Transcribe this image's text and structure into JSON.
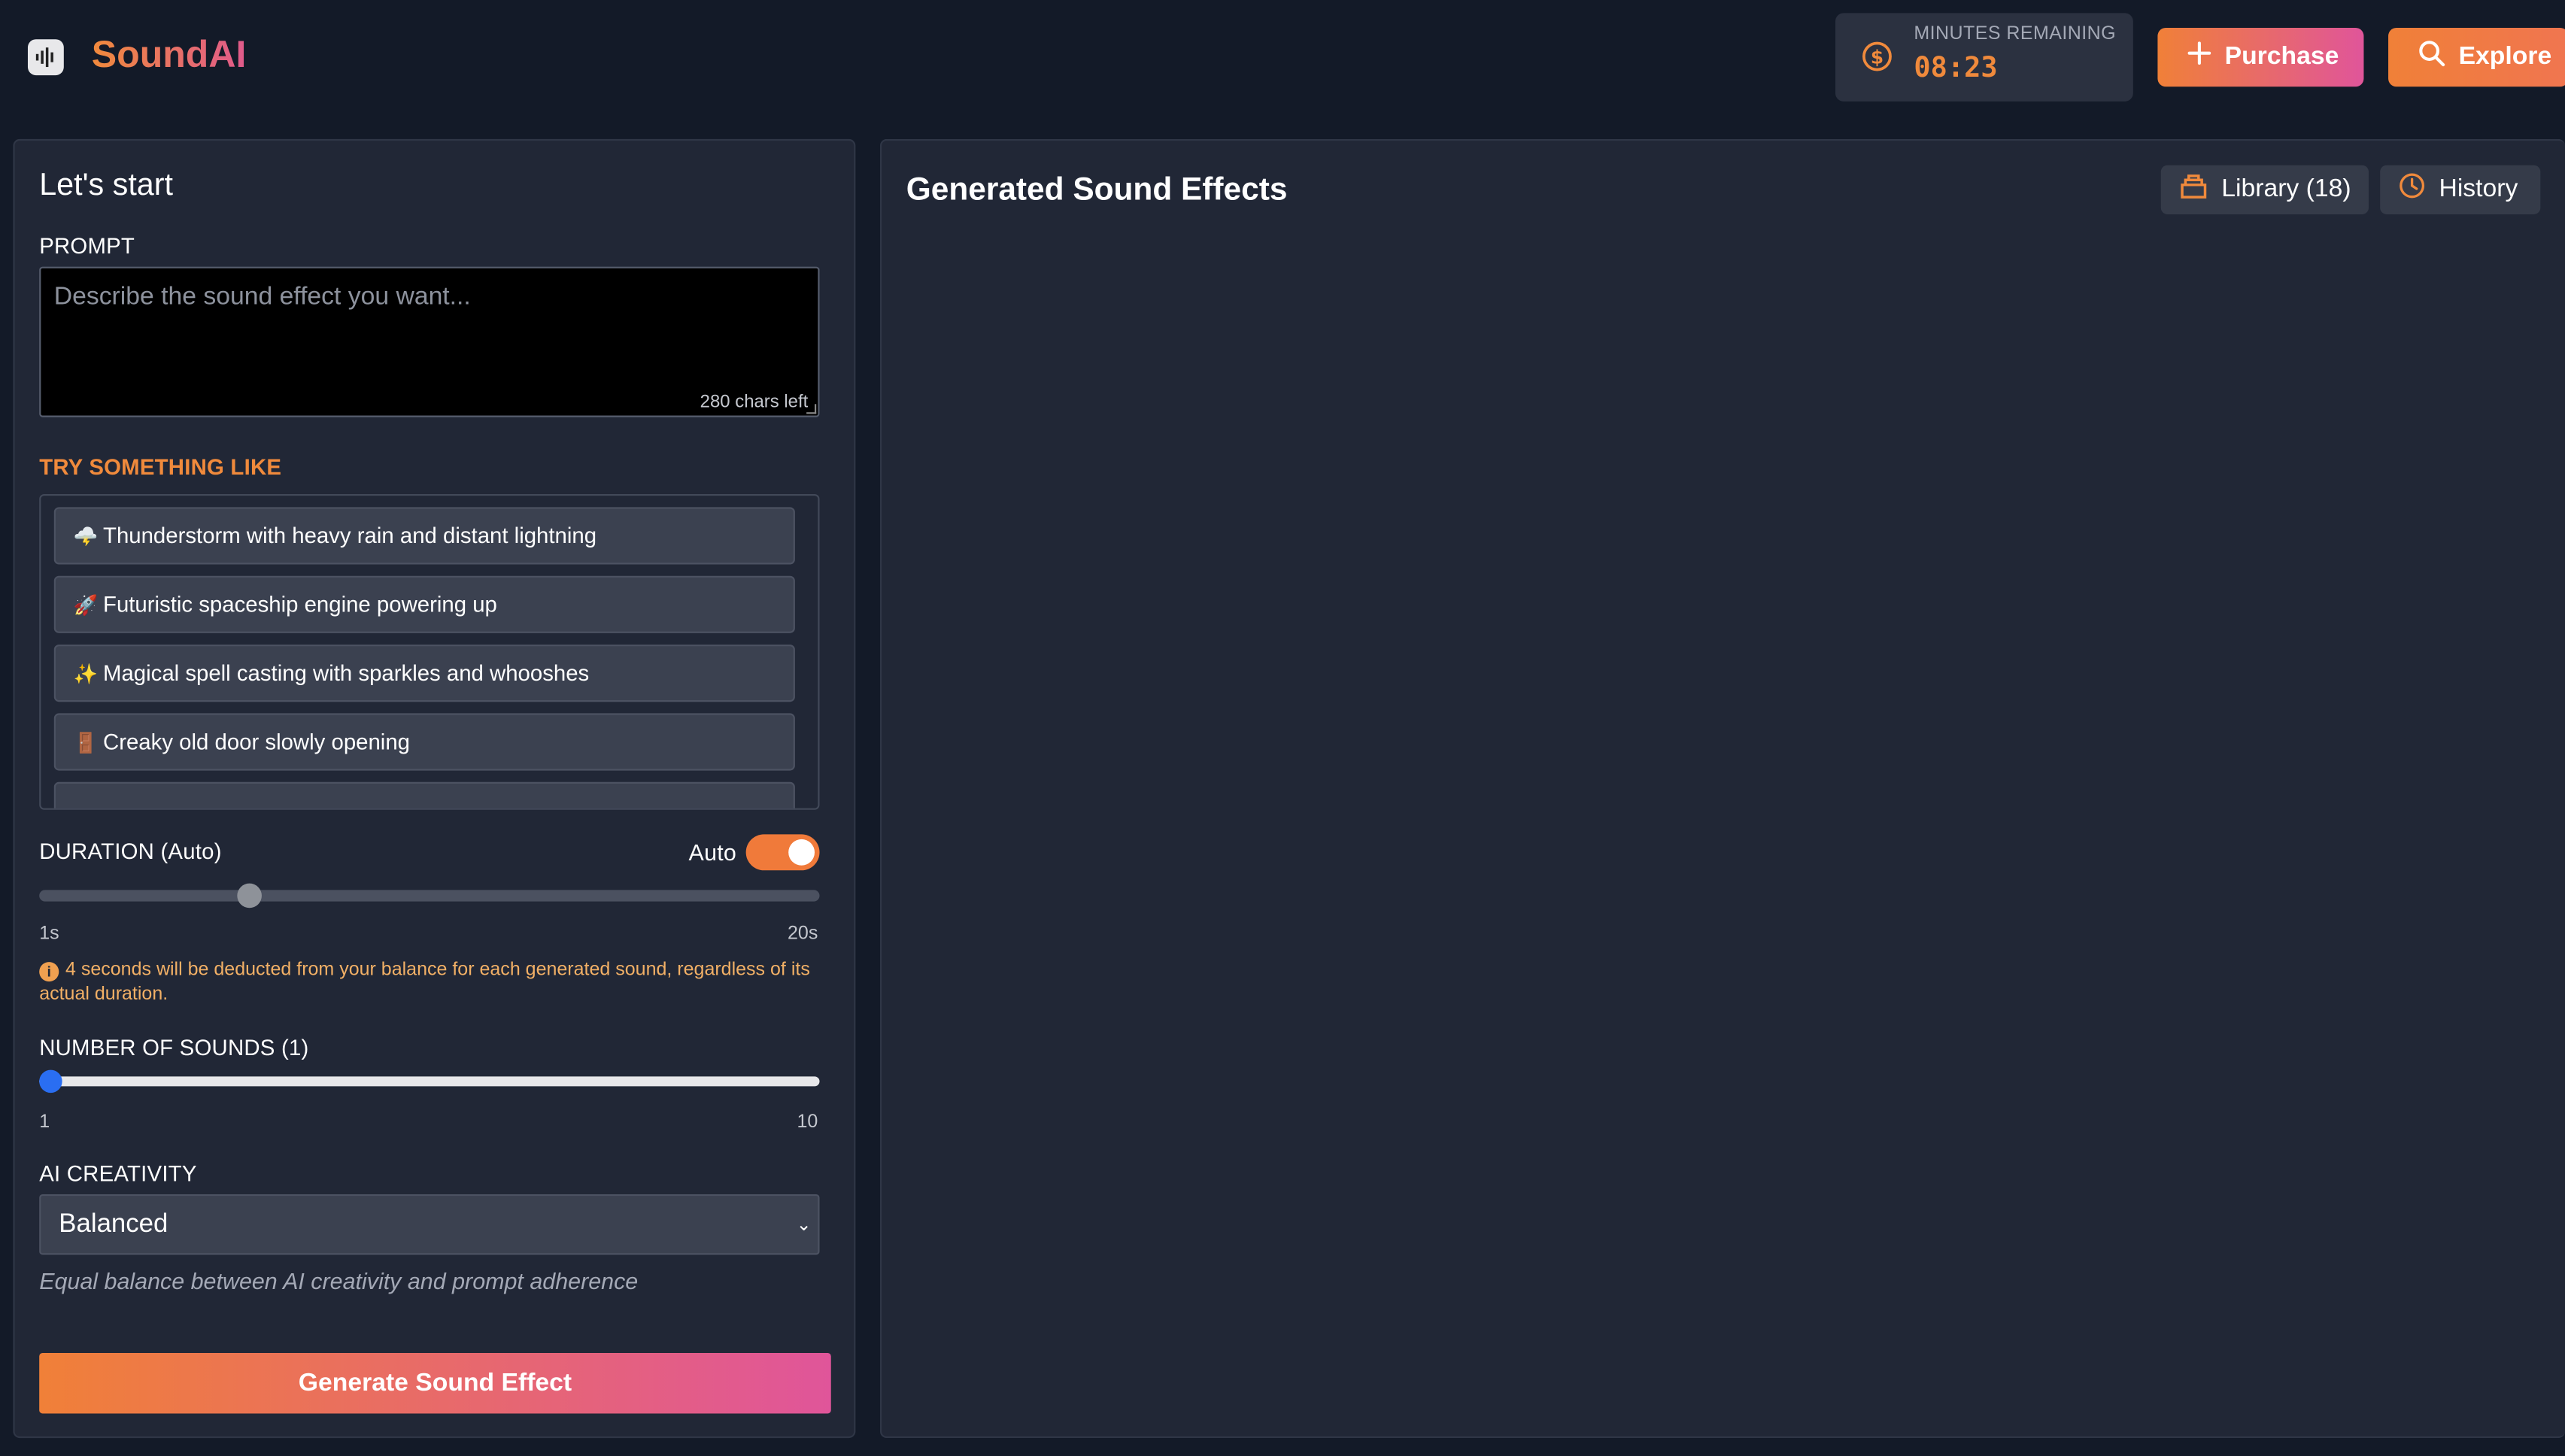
{
  "header": {
    "app_name": "SoundAI",
    "minutes_label": "MINUTES REMAINING",
    "minutes_value": "08:23",
    "purchase_label": "Purchase",
    "explore_label": "Explore"
  },
  "left": {
    "heading": "Let's start",
    "prompt_label": "PROMPT",
    "prompt_placeholder": "Describe the sound effect you want...",
    "chars_left": "280 chars left",
    "try_label": "TRY SOMETHING LIKE",
    "suggestions": [
      {
        "emoji": "🌩️",
        "text": "Thunderstorm with heavy rain and distant lightning"
      },
      {
        "emoji": "🚀",
        "text": "Futuristic spaceship engine powering up"
      },
      {
        "emoji": "✨",
        "text": "Magical spell casting with sparkles and whooshes"
      },
      {
        "emoji": "🚪",
        "text": "Creaky old door slowly opening"
      }
    ],
    "duration_label": "DURATION (Auto)",
    "auto_label": "Auto",
    "auto_enabled": true,
    "duration_min": "1s",
    "duration_max": "20s",
    "duration_value_fraction": 0.27,
    "notice_icon": "i",
    "notice": "4 seconds will be deducted from your balance for each generated sound, regardless of its actual duration.",
    "sounds_label": "NUMBER OF SOUNDS (1)",
    "sounds_min": "1",
    "sounds_max": "10",
    "sounds_value": 1,
    "creativity_label": "AI CREATIVITY",
    "creativity_selected": "Balanced",
    "creativity_chevron": "⌄",
    "creativity_desc": "Equal balance between AI creativity and prompt adherence",
    "generate_label": "Generate Sound Effect"
  },
  "right": {
    "title": "Generated Sound Effects",
    "library_label": "Library (18)",
    "history_label": "History"
  },
  "colors": {
    "accent_orange": "#f08a3c",
    "accent_pink": "#e0559a",
    "background": "#131a28",
    "panel": "#212736"
  },
  "icons": {
    "logo": "waveform-icon",
    "minutes": "dollar-coin-icon",
    "purchase": "plus-icon",
    "explore": "search-icon",
    "library": "archive-icon",
    "history": "clock-icon"
  }
}
